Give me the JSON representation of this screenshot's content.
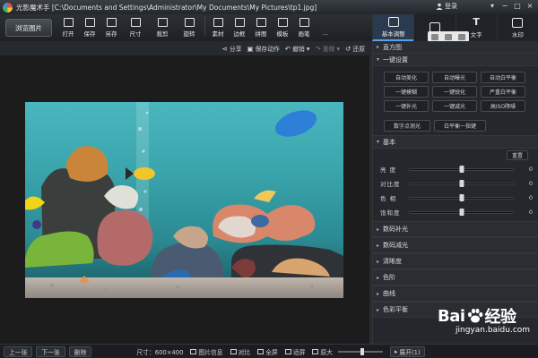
{
  "window": {
    "title": "光影魔术手  [C:\\Documents and Settings\\Administrator\\My Documents\\My Pictures\\tp1.jpg]",
    "login": "登录",
    "controls": [
      "▾",
      "−",
      "□",
      "×"
    ]
  },
  "toolbar": {
    "open_label": "浏览图片",
    "tools": [
      {
        "label": "打开",
        "icon": "open-icon"
      },
      {
        "label": "保存",
        "icon": "save-icon"
      },
      {
        "label": "另存",
        "icon": "save-as-icon"
      },
      {
        "label": "尺寸",
        "icon": "resize-icon"
      },
      {
        "label": "裁剪",
        "icon": "crop-icon"
      },
      {
        "label": "旋转",
        "icon": "rotate-icon"
      },
      {
        "label": "素材",
        "icon": "material-icon"
      },
      {
        "label": "边框",
        "icon": "frame-icon"
      },
      {
        "label": "拼图",
        "icon": "collage-icon"
      },
      {
        "label": "模板",
        "icon": "template-icon"
      },
      {
        "label": "画笔",
        "icon": "brush-icon"
      },
      {
        "label": "...",
        "icon": "more-icon"
      }
    ]
  },
  "right_tabs": [
    {
      "label": "基本调整",
      "icon": "adjust-icon",
      "active": true
    },
    {
      "label": "",
      "icon": "camera-icon",
      "active": false
    },
    {
      "label": "文字",
      "icon": "text-icon",
      "active": false
    },
    {
      "label": "水印",
      "icon": "watermark-icon",
      "active": false
    }
  ],
  "actionbar": {
    "share": "分享",
    "save_action": "保存动作",
    "undo": "撤销",
    "redo": "重做",
    "restore": "还原"
  },
  "panel": {
    "histogram": "直方图",
    "oneclick_title": "一键设置",
    "oneclick_buttons": [
      "自动美化",
      "自动曝光",
      "自动白平衡",
      "一键模糊",
      "一键锐化",
      "严重白平衡",
      "一键补光",
      "一键减光",
      "高ISO降噪"
    ],
    "oneclick_extra": [
      "数字点测光",
      "白平衡一指键"
    ],
    "basic_title": "基本",
    "reset": "重置",
    "sliders": [
      {
        "label": "亮 度",
        "value": "0",
        "level": 0.5
      },
      {
        "label": "对比度",
        "value": "0",
        "level": 0.5
      },
      {
        "label": "色 相",
        "value": "0",
        "level": 0.5
      },
      {
        "label": "饱和度",
        "value": "0",
        "level": 0.5
      }
    ],
    "folded_sections": [
      "数码补光",
      "数码减光",
      "清晰度",
      "色阶",
      "曲线",
      "色彩平衡"
    ]
  },
  "statusbar": {
    "prev": "上一张",
    "next": "下一张",
    "delete": "删除",
    "size": "尺寸：600×400",
    "info": "图片信息",
    "compare": "对比",
    "fullscreen": "全屏",
    "fit": "适屏",
    "original": "原大",
    "zoom_level": 0.5,
    "expand": "展开(1)"
  },
  "watermark": {
    "brand_left": "Bai",
    "brand_right": "经验",
    "url": "jingyan.baidu.com"
  },
  "colors": {
    "accent": "#5aa0e6",
    "water_top": "#4ab6bd",
    "water_bottom": "#1a5960"
  }
}
